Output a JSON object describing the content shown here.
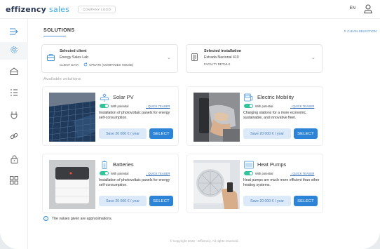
{
  "header": {
    "logo_part1": "effizency",
    "logo_part2": "sales",
    "company_logo": "COMPANY LOGO",
    "lang": "EN"
  },
  "sidebar": {
    "icons": [
      "collapse-menu-icon",
      "gear-icon",
      "building-icon",
      "list-icon",
      "plug-icon",
      "link-icon",
      "lock-icon",
      "grid-icon"
    ]
  },
  "page": {
    "title": "SOLUTIONS",
    "clean_selection": "✕ CLEAN SELECTION",
    "available": "Available solutions"
  },
  "client": {
    "label": "Selected client",
    "name": "Energy Sales Lab",
    "link1": "CLIENT DATA",
    "link2": "UPDATE (COMPANIES HOUSE)"
  },
  "installation": {
    "label": "Selected installation",
    "name": "Estrada Nacional 410",
    "link1": "FACILITY DETAILS"
  },
  "cards": [
    {
      "title": "Solar PV",
      "potential": "With potential",
      "teaser": "QUICK TEASER",
      "desc": "Installation of photovoltaic panels for energy self-consumption.",
      "save": "Save 20 000 € / year",
      "select": "SELECT"
    },
    {
      "title": "Electric Mobility",
      "potential": "With potential",
      "teaser": "QUICK TEASER",
      "desc": "Charging stations for a more economic, sustainable, and innovative fleet.",
      "save": "Save 20 000 € / year",
      "select": "SELECT"
    },
    {
      "title": "Batteries",
      "potential": "With potential",
      "teaser": "QUICK TEASER",
      "desc": "Installation of photovoltaic panels for energy self-consumption.",
      "save": "Save 20 000 € / year",
      "select": "SELECT"
    },
    {
      "title": "Heat Pumps",
      "potential": "With potential",
      "teaser": "QUICK TEASER",
      "desc": "Heat pumps are much more efficient than other heating systems.",
      "save": "Save 20 000 € / year",
      "select": "SELECT"
    }
  ],
  "footer": {
    "note": "The values given are approximations.",
    "copyright": "© Copyright 2022 - Effizency. All rights reserved."
  },
  "colors": {
    "accent": "#2d84d7",
    "toggle": "#34c39a",
    "logo_dark": "#2b3a55",
    "logo_light": "#3ea7e8"
  }
}
